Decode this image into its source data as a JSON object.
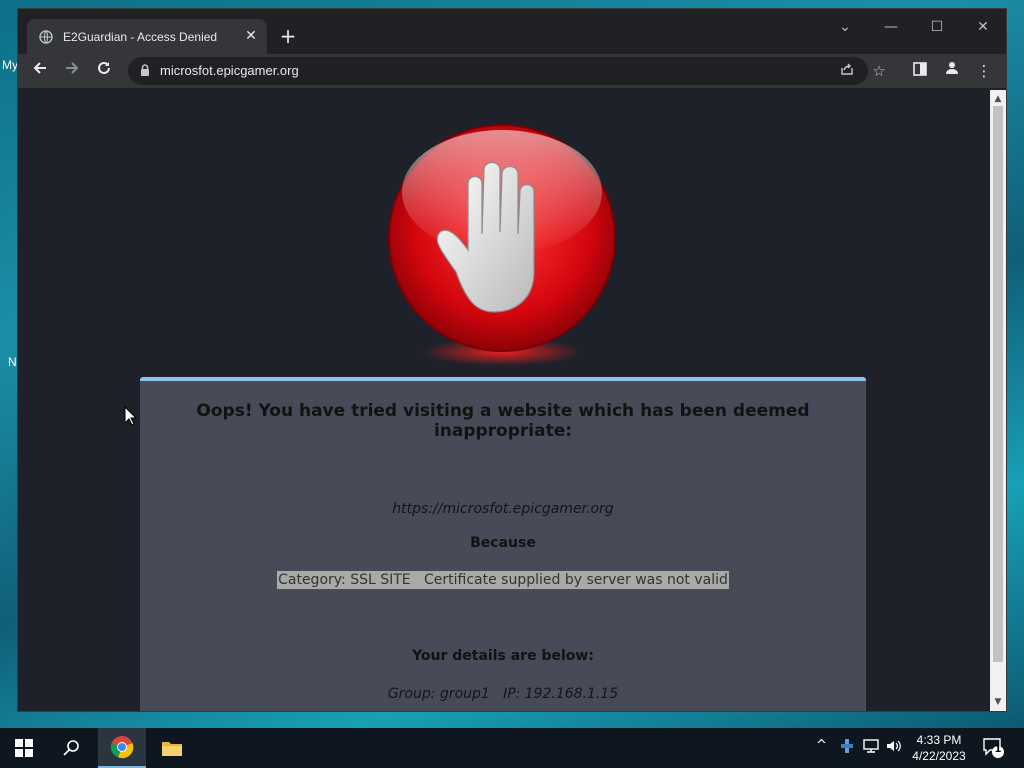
{
  "desktop": {
    "icon_labels": [
      "My",
      "N"
    ]
  },
  "browser": {
    "tab": {
      "title": "E2Guardian - Access Denied"
    },
    "address": {
      "url": "microsfot.epicgamer.org"
    },
    "icons": {
      "back": "arrow-left-icon",
      "forward": "arrow-right-icon",
      "reload": "reload-icon",
      "lock": "lock-icon",
      "share": "share-icon",
      "bookmark": "star-icon",
      "side_panel": "side-panel-icon",
      "profile": "profile-icon",
      "menu": "kebab-menu-icon"
    }
  },
  "page": {
    "heading": "Oops! You have tried visiting a website which has been deemed inappropriate:",
    "blocked_url": "https://microsfot.epicgamer.org",
    "because_label": "Because",
    "reason": "Category: SSL SITE   Certificate supplied by server was not valid",
    "details_label": "Your details are below:",
    "group_ip": "Group: group1   IP: 192.168.1.15"
  },
  "taskbar": {
    "clock": {
      "time": "4:33 PM",
      "date": "4/22/2023"
    },
    "notification_count": "1"
  },
  "colors": {
    "panel_bg": "#464b57",
    "panel_border": "#8ec3ee",
    "page_bg": "#1e2129",
    "stop_red": "#e0141b"
  }
}
